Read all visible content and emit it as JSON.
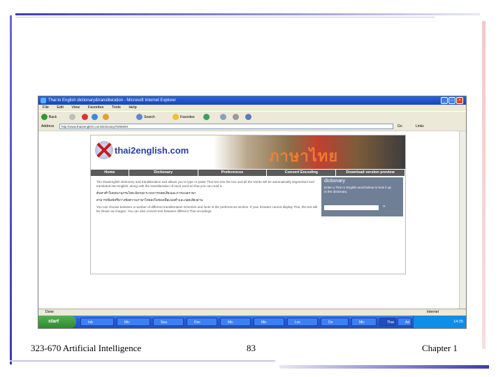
{
  "slide": {
    "footer_left": "323-670 Artificial Intelligence",
    "footer_center": "83",
    "footer_right": "Chapter 1"
  },
  "browser": {
    "title": "Thai to English dictionary&transliteration - Microsoft Internet Explorer",
    "menu": [
      "File",
      "Edit",
      "View",
      "Favorites",
      "Tools",
      "Help"
    ],
    "toolbar": {
      "back": "Back",
      "search": "Search",
      "favorites": "Favorites"
    },
    "address_label": "Address",
    "address_value": "http://www.thai2english.com/dictionary/#256593",
    "go_label": "Go",
    "links_label": "Links",
    "status_left": "Done",
    "status_right": "Internet"
  },
  "site": {
    "logo": "thai2english.com",
    "banner_thai": "ภาษาไทย",
    "nav": [
      "Home",
      "Dictionary",
      "Preferences",
      "Convert Encoding",
      "Download version preview"
    ],
    "intro": "The thai2english dictionary and transliteration tool allows you to type or paste Thai text into the box and all the words will be automatically segmented and translated into English, along with the transliteration of each word so that you can read it.",
    "thai_line1": "ค้นหาคำในพจนานุกรมไทย-อังกฤษ ระบบการถอดเสียงและการแปลภาษา",
    "thai_line2": "สามารถพิมพ์หรือวางข้อความภาษาไทยลงในช่องเพื่อแปลคำและถอดเสียงอ่าน",
    "body": "You can choose between a number of different transliteration schemes and fonts in the preferences section. If your browser cannot display Thai, the text will be shown as images. You can also convert text between different Thai encodings.",
    "side_title": "dictionary",
    "side_desc": "Enter a Thai or English word below to look it up in the dictionary.",
    "side_go": "»"
  },
  "taskbar": {
    "start": "start",
    "tasks": [
      "Inb",
      "Mic",
      "Sea",
      "Doc",
      "Mic",
      "Mic",
      "Loc",
      "Do",
      "Mic",
      "Thai",
      "Ad"
    ],
    "clock": "14:25"
  }
}
